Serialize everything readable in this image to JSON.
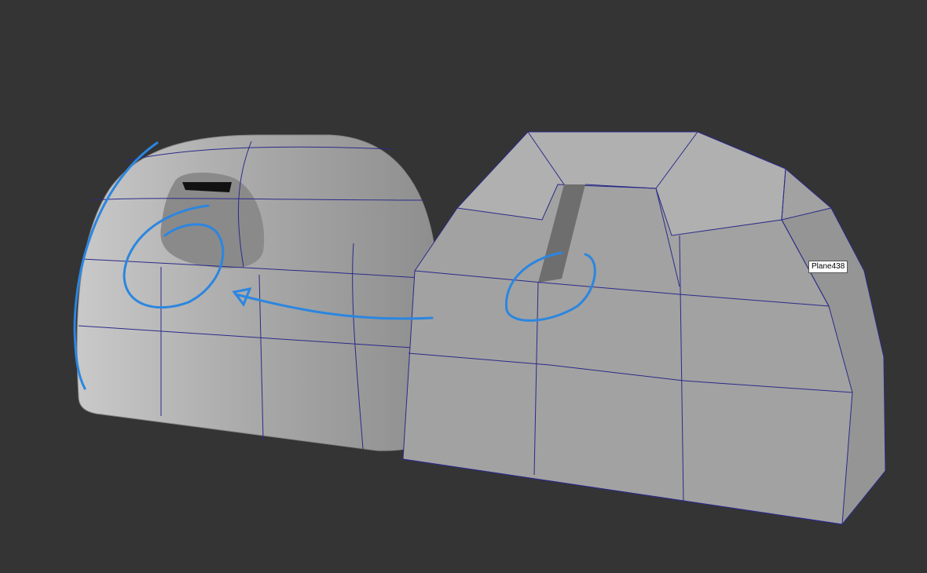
{
  "viewport": {
    "tooltip": "Plane438",
    "colors": {
      "background": "#343434",
      "mesh": "#a6a6a6",
      "wire": "#2a2a8a",
      "annotation": "#2b86e0"
    }
  }
}
